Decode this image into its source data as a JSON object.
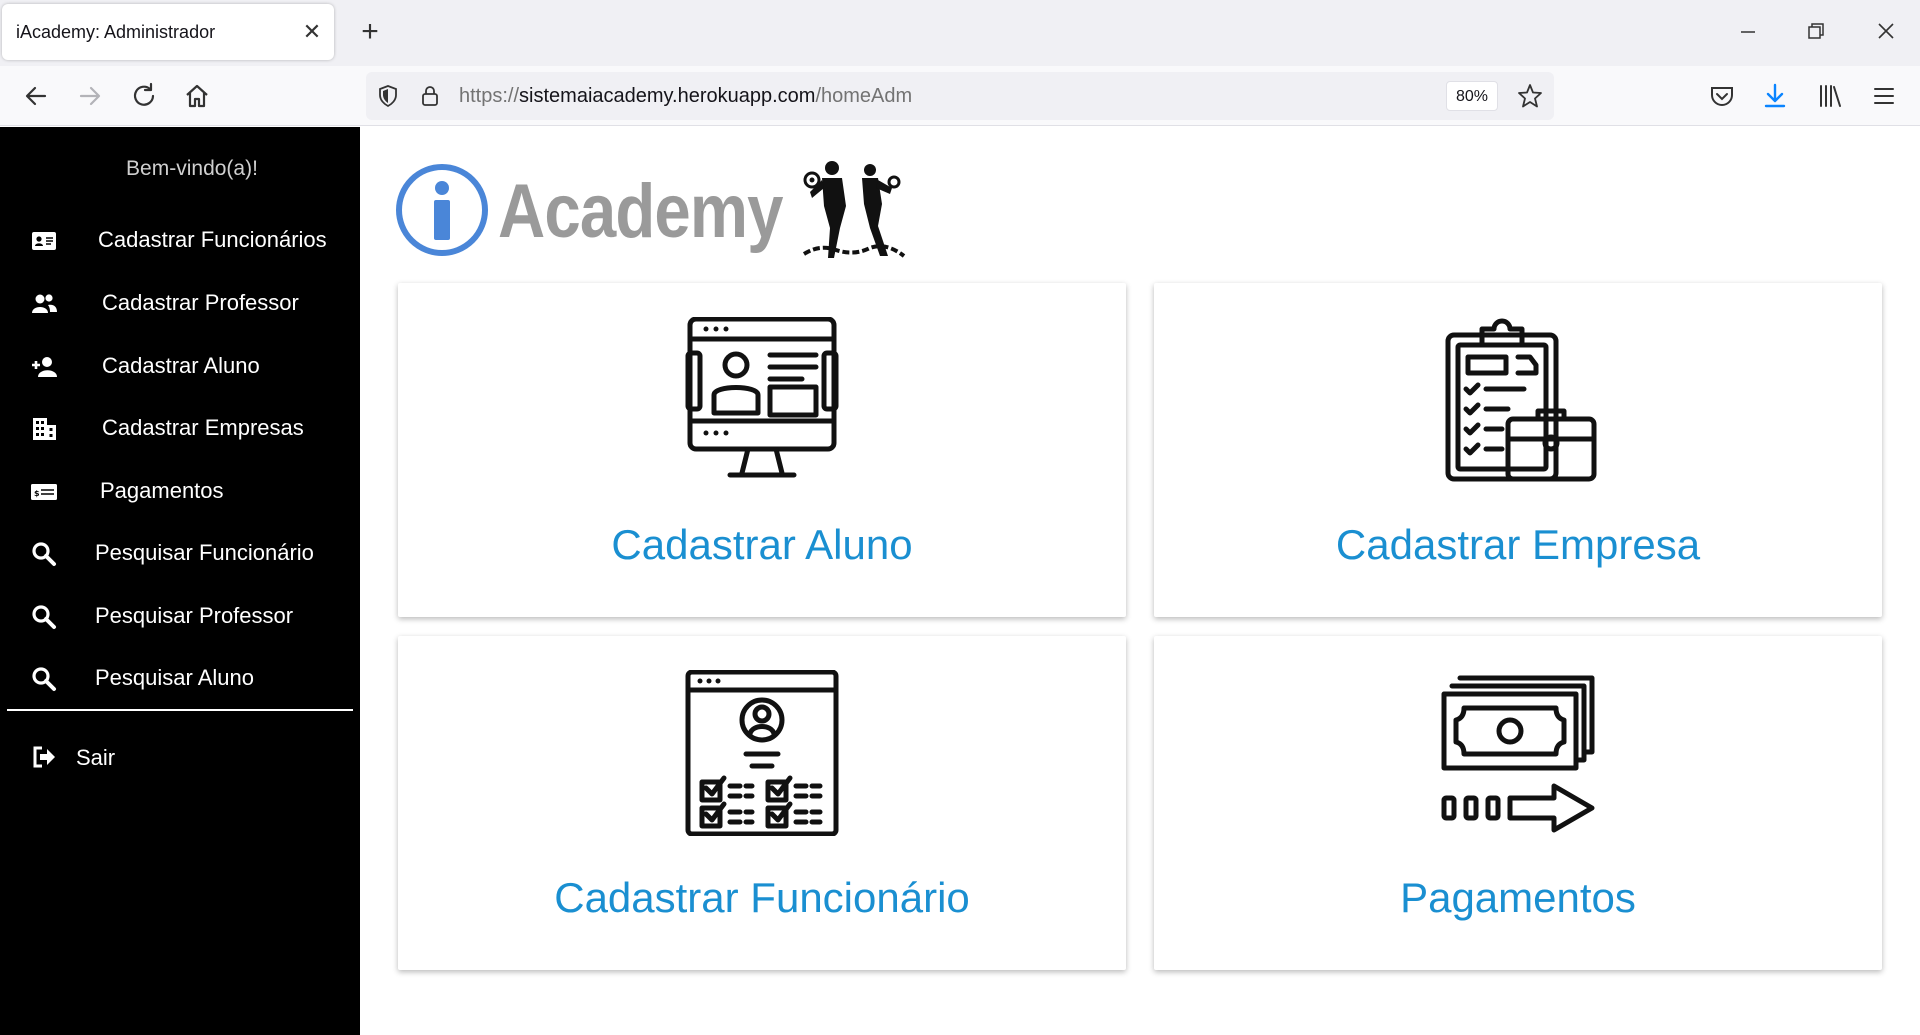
{
  "browser": {
    "tab_title": "iAcademy: Administrador",
    "url_host_prefix": "https://",
    "url_host": "sistemaiacademy.herokuapp.com",
    "url_path": "/homeAdm",
    "zoom": "80%"
  },
  "sidebar": {
    "welcome": "Bem-vindo(a)!",
    "items": [
      {
        "label": "Cadastrar Funcionários",
        "icon": "id-card-icon"
      },
      {
        "label": "Cadastrar Professor",
        "icon": "users-icon"
      },
      {
        "label": "Cadastrar Aluno",
        "icon": "user-plus-icon"
      },
      {
        "label": "Cadastrar Empresas",
        "icon": "building-icon"
      },
      {
        "label": "Pagamentos",
        "icon": "money-bill-icon"
      },
      {
        "label": "Pesquisar Funcionário",
        "icon": "search-icon"
      },
      {
        "label": "Pesquisar Professor",
        "icon": "search-icon"
      },
      {
        "label": "Pesquisar Aluno",
        "icon": "search-icon"
      }
    ],
    "logout": "Sair"
  },
  "logo": {
    "text": "Academy"
  },
  "cards": [
    {
      "label": "Cadastrar Aluno",
      "icon": "computer-profile-icon"
    },
    {
      "label": "Cadastrar Empresa",
      "icon": "clipboard-briefcase-icon"
    },
    {
      "label": "Cadastrar Funcionário",
      "icon": "profile-checklist-icon"
    },
    {
      "label": "Pagamentos",
      "icon": "payment-cash-icon"
    }
  ]
}
